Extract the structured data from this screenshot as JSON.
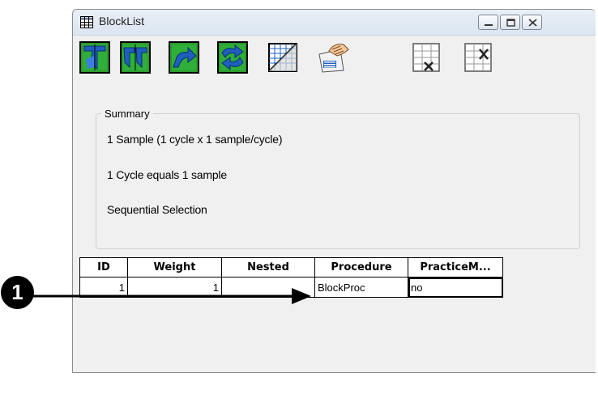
{
  "window": {
    "title": "BlockList",
    "controls": [
      "minimize-icon",
      "maximize-icon",
      "close-icon"
    ]
  },
  "toolbar": {
    "buttons": [
      {
        "name": "set-attributes-icon"
      },
      {
        "name": "add-levels-icon"
      },
      {
        "name": "insert-level-icon"
      },
      {
        "name": "remove-levels-icon"
      },
      {
        "name": "grid-properties-icon"
      },
      {
        "name": "list-properties-icon"
      },
      {
        "name": "delete-level-icon"
      },
      {
        "name": "delete-attribute-icon"
      }
    ]
  },
  "summary": {
    "legend": "Summary",
    "lines": [
      "1 Sample (1 cycle x 1 sample/cycle)",
      "1 Cycle equals 1 sample",
      "Sequential Selection"
    ]
  },
  "grid": {
    "columns": [
      "ID",
      "Weight",
      "Nested",
      "Procedure",
      "PracticeM..."
    ],
    "rows": [
      [
        "1",
        "1",
        "",
        "BlockProc",
        "no"
      ]
    ]
  },
  "callout": {
    "number": "1"
  },
  "colors": {
    "title_bar": "#dbe5f1",
    "window_bg": "#f0f0f0",
    "icon_blue": "#1f5fbf",
    "icon_green": "#2c9a2c"
  }
}
